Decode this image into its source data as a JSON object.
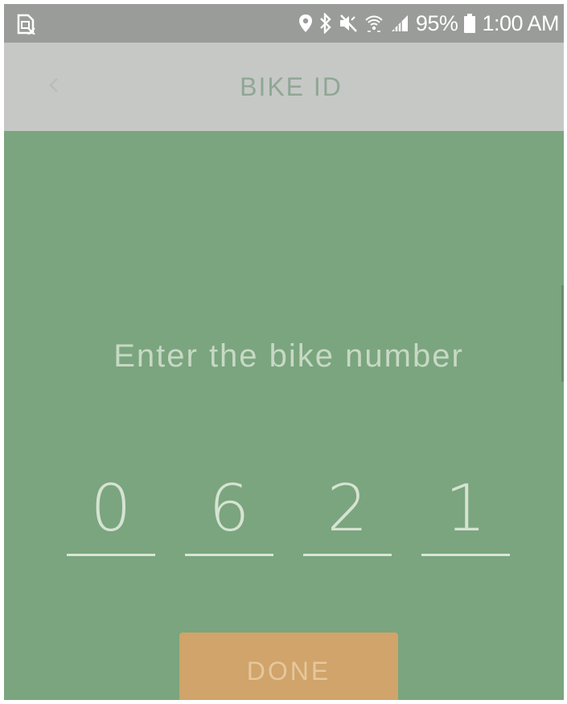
{
  "status_bar": {
    "left_icon": "no-sim-icon",
    "icons": [
      "location-icon",
      "bluetooth-icon",
      "mute-icon",
      "wifi-icon",
      "signal-icon"
    ],
    "battery_text": "95%",
    "battery_icon": "battery-icon",
    "time": "1:00 AM"
  },
  "header": {
    "back_icon": "back-arrow-icon",
    "title": "BIKE ID"
  },
  "main": {
    "prompt": "Enter the bike number",
    "digits": [
      "0",
      "6",
      "2",
      "1"
    ],
    "done_label": "DONE"
  },
  "colors": {
    "status_bar_bg": "#9a9c9a",
    "header_bg": "#c6c8c6",
    "main_bg": "#7aa57e",
    "accent_button": "#d0a46a"
  }
}
